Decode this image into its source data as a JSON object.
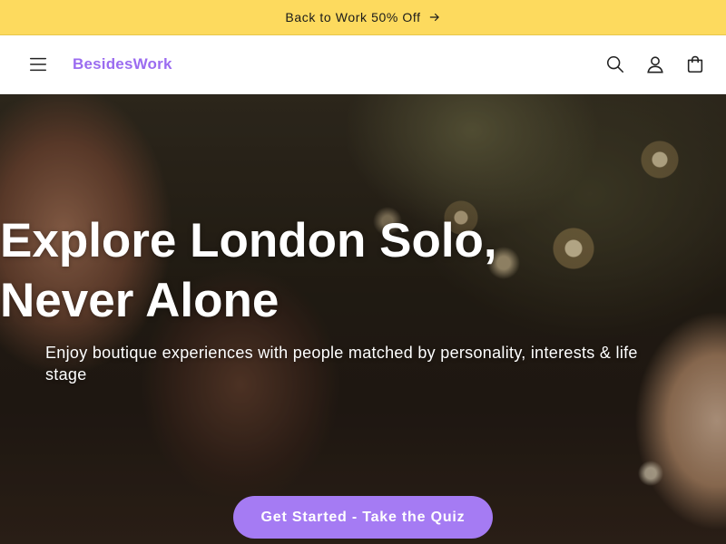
{
  "announcement": {
    "text": "Back to Work 50% Off",
    "icon": "arrow-right-icon"
  },
  "header": {
    "logo": "BesidesWork",
    "menu_icon": "hamburger-menu-icon",
    "icons": [
      "search-icon",
      "account-icon",
      "cart-icon"
    ]
  },
  "hero": {
    "title_line1": "Explore London Solo,",
    "title_line2": "Never Alone",
    "subtitle": "Enjoy boutique experiences with people matched by personality, interests & life stage",
    "cta_label": "Get Started - Take the Quiz"
  },
  "colors": {
    "announcement_bg": "#fdda5e",
    "brand": "#9b6cf0",
    "cta_bg": "#a57bf3"
  }
}
